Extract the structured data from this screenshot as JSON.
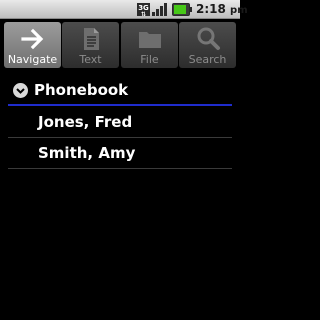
{
  "status_bar": {
    "network_badge": "3G",
    "time": "2:18",
    "ampm": "pm",
    "icons": [
      "3g-data-icon",
      "signal-strength-icon",
      "battery-icon"
    ],
    "battery_color": "#47c818"
  },
  "tabs": [
    {
      "label": "Navigate",
      "icon": "arrow-right-icon",
      "active": true
    },
    {
      "label": "Text",
      "icon": "document-icon",
      "active": false
    },
    {
      "label": "File",
      "icon": "folder-icon",
      "active": false
    },
    {
      "label": "Search",
      "icon": "magnifier-icon",
      "active": false
    }
  ],
  "list": {
    "header": "Phonebook",
    "header_icon": "chevron-down-icon",
    "accent_color": "#1f2ccc",
    "items": [
      "Jones, Fred",
      "Smith, Amy"
    ]
  }
}
